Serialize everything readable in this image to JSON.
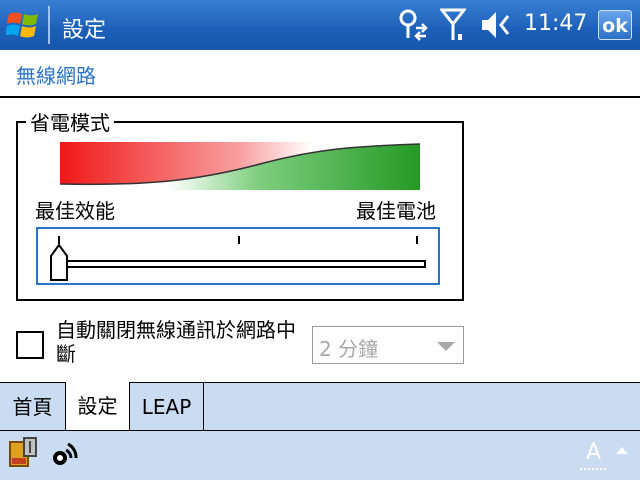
{
  "titlebar": {
    "app_title": "設定",
    "time": "11:47",
    "ok_label": "ok",
    "icons": [
      "windows-start-icon",
      "connectivity-icon",
      "signal-strength-icon",
      "volume-icon"
    ]
  },
  "section": {
    "title": "無線網路"
  },
  "power_mode": {
    "legend": "省電模式",
    "left_label": "最佳效能",
    "right_label": "最佳電池",
    "slider_value_fraction": 0.0,
    "colors": {
      "performance": "#ff2020",
      "battery": "#2ca02c",
      "accent": "#2a73c8"
    }
  },
  "auto_off": {
    "label": "自動關閉無線通訊於網路中斷",
    "checked": false,
    "dropdown_value": "2  分鐘"
  },
  "tabs": [
    {
      "label": "首頁",
      "active": false
    },
    {
      "label": "設定",
      "active": true
    },
    {
      "label": "LEAP",
      "active": false
    }
  ],
  "bottombar": {
    "input_label": "A",
    "icons": [
      "network-card-icon",
      "wireless-status-icon",
      "input-panel-icon",
      "input-menu-arrow-icon"
    ]
  }
}
